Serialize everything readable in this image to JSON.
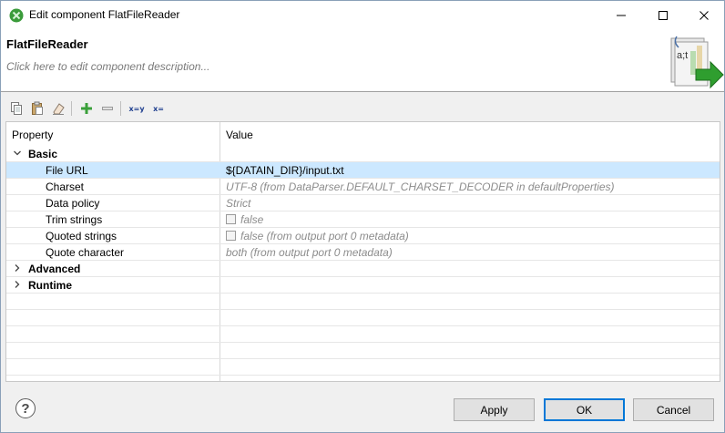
{
  "window": {
    "title": "Edit component FlatFileReader"
  },
  "header": {
    "component_name": "FlatFileReader",
    "description_placeholder": "Click here to edit component description..."
  },
  "toolbar": {
    "icons": [
      "copy-icon",
      "paste-icon",
      "clear-icon",
      "add-icon",
      "remove-icon",
      "variable-icon",
      "variable-edit-icon"
    ],
    "var1_label": "x=y",
    "var2_label": "x="
  },
  "table": {
    "col_property": "Property",
    "col_value": "Value",
    "basic": {
      "label": "Basic",
      "rows": [
        {
          "property": "File URL",
          "value": "${DATAIN_DIR}/input.txt"
        },
        {
          "property": "Charset",
          "value": "UTF-8 (from DataParser.DEFAULT_CHARSET_DECODER in defaultProperties)"
        },
        {
          "property": "Data policy",
          "value": "Strict"
        },
        {
          "property": "Trim strings",
          "value": "false"
        },
        {
          "property": "Quoted strings",
          "value": "false (from output port 0 metadata)"
        },
        {
          "property": "Quote character",
          "value": "both (from output port 0 metadata)"
        }
      ]
    },
    "advanced": {
      "label": "Advanced"
    },
    "runtime": {
      "label": "Runtime"
    }
  },
  "footer": {
    "help": "?",
    "apply": "Apply",
    "ok": "OK",
    "cancel": "Cancel"
  },
  "colors": {
    "selection": "#cce8ff",
    "default_text": "#8c8c8c"
  }
}
